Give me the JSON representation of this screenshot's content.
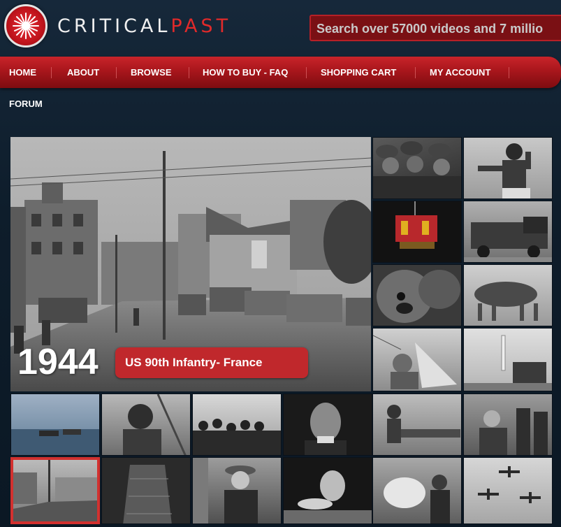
{
  "header": {
    "logo_white": "CRITICAL",
    "logo_red": "PAST",
    "search_placeholder": "Search over 57000 videos and 7 millio"
  },
  "nav": {
    "items": [
      {
        "label": "HOME"
      },
      {
        "label": "ABOUT"
      },
      {
        "label": "BROWSE"
      },
      {
        "label": "HOW TO BUY - FAQ"
      },
      {
        "label": "SHOPPING CART"
      },
      {
        "label": "MY ACCOUNT"
      }
    ],
    "forum": "FORUM"
  },
  "featured": {
    "year": "1944",
    "caption": "US 90th Infantry- France"
  },
  "colors": {
    "accent": "#c0282c",
    "background": "#0e1d2b",
    "nav": "#a8161c"
  }
}
